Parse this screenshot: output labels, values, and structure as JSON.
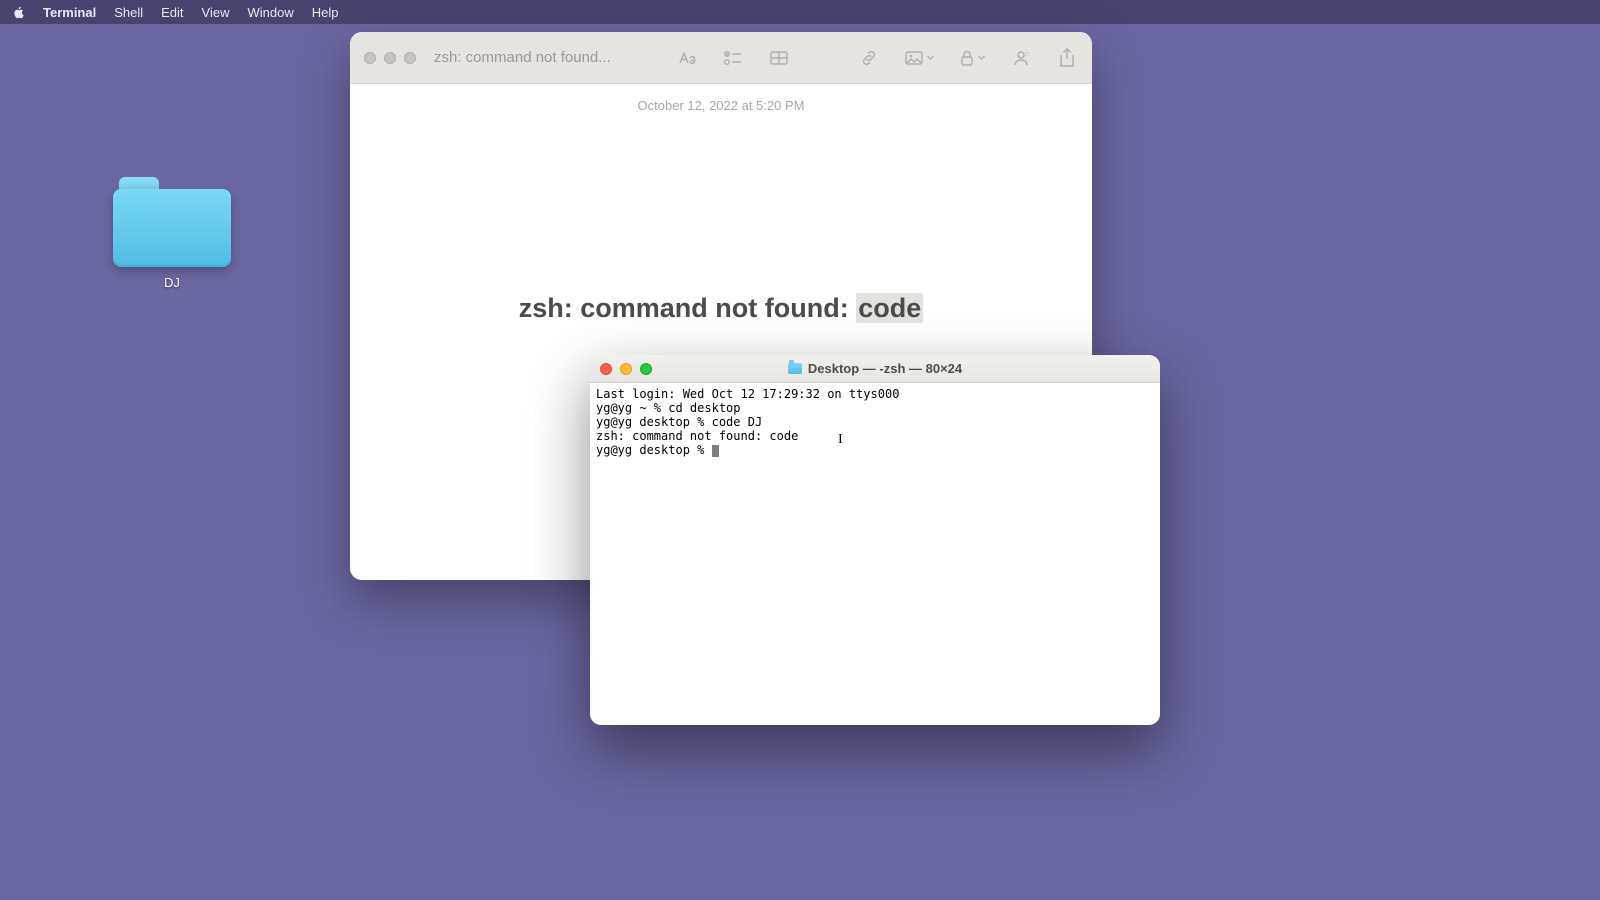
{
  "menubar": {
    "app": "Terminal",
    "items": [
      "Shell",
      "Edit",
      "View",
      "Window",
      "Help"
    ]
  },
  "desktop": {
    "folder_name": "DJ"
  },
  "notes": {
    "title_truncated": "zsh: command not found...",
    "date": "October 12, 2022 at 5:20 PM",
    "heading_prefix": "zsh: command not found: ",
    "heading_highlight": "code"
  },
  "terminal": {
    "title": "Desktop — -zsh — 80×24",
    "lines": [
      "Last login: Wed Oct 12 17:29:32 on ttys000",
      "yg@yg ~ % cd desktop",
      "yg@yg desktop % code DJ",
      "zsh: command not found: code",
      "yg@yg desktop % "
    ]
  }
}
